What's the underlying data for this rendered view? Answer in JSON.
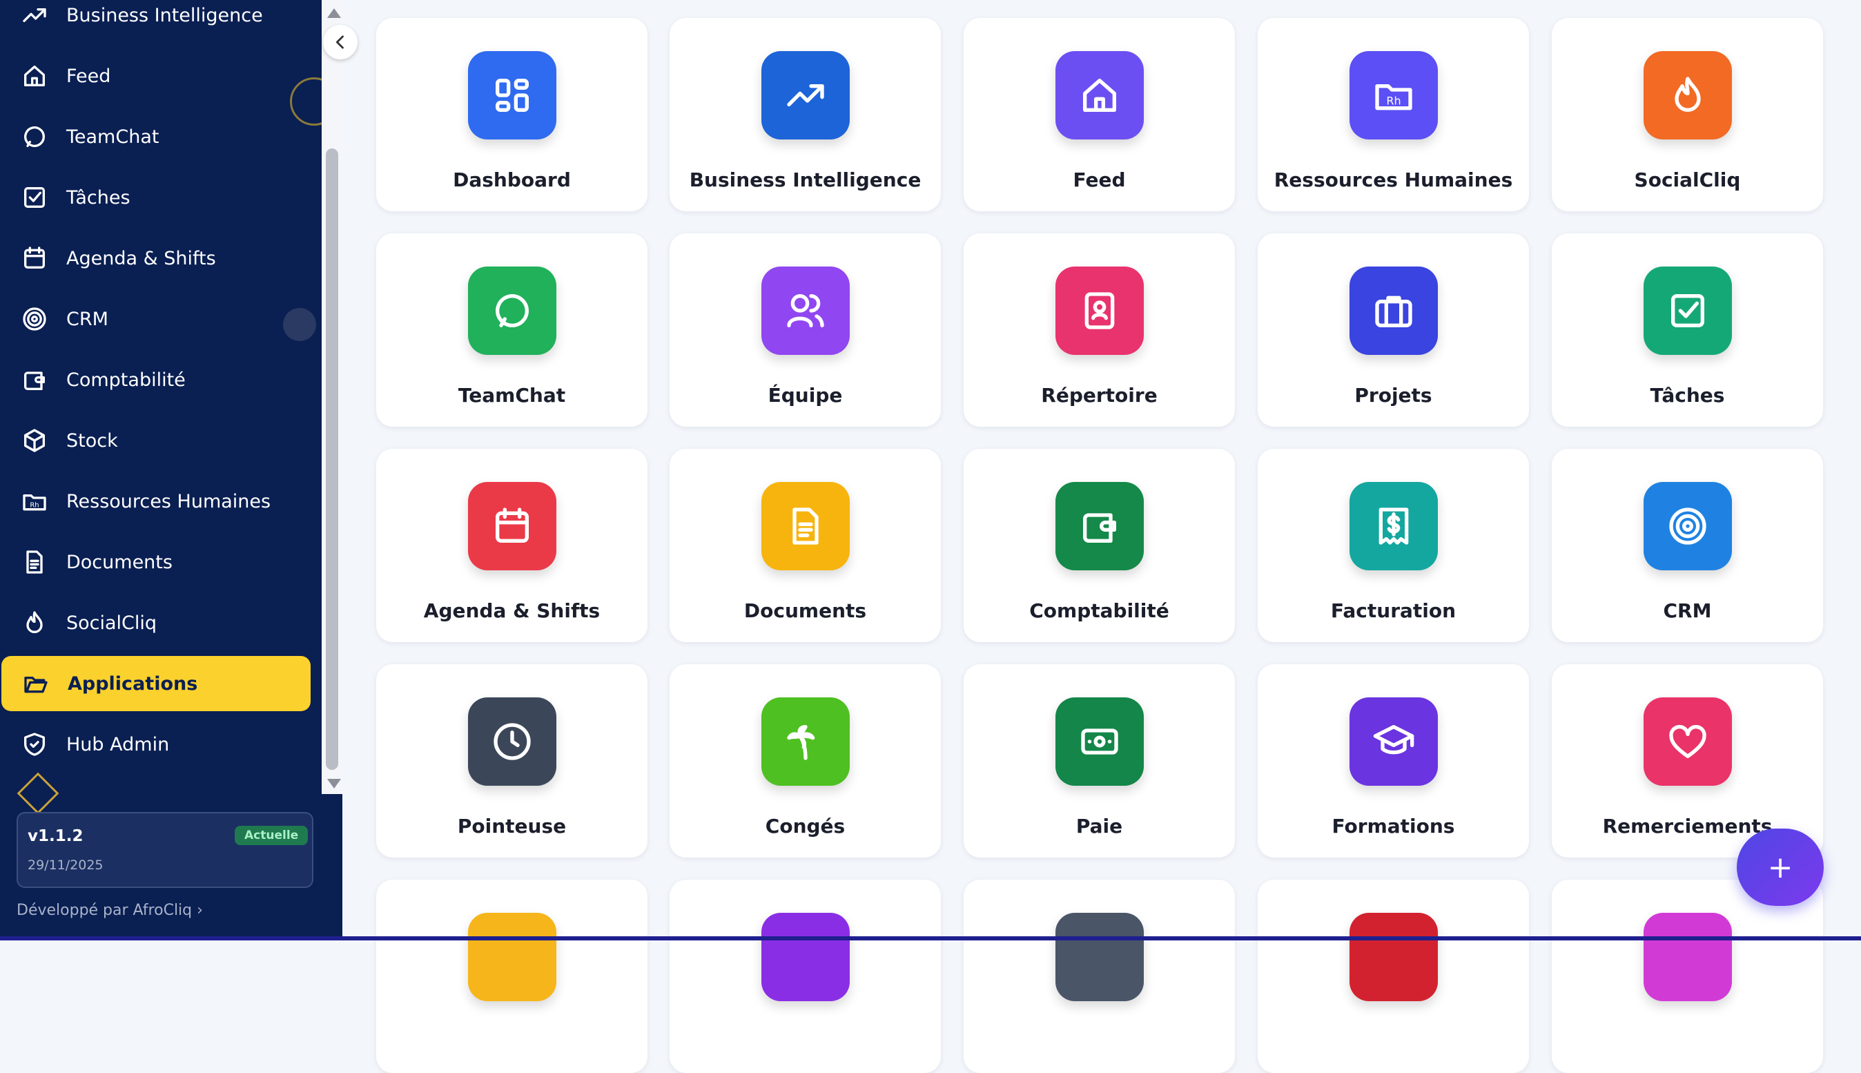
{
  "sidebar": {
    "items": [
      {
        "label": "Business Intelligence",
        "icon": "trending-up-icon"
      },
      {
        "label": "Feed",
        "icon": "home-icon"
      },
      {
        "label": "TeamChat",
        "icon": "message-circle-icon"
      },
      {
        "label": "Tâches",
        "icon": "checkbox-icon"
      },
      {
        "label": "Agenda & Shifts",
        "icon": "calendar-icon"
      },
      {
        "label": "CRM",
        "icon": "target-icon"
      },
      {
        "label": "Comptabilité",
        "icon": "wallet-icon"
      },
      {
        "label": "Stock",
        "icon": "package-icon"
      },
      {
        "label": "Ressources Humaines",
        "icon": "folder-rh-icon"
      },
      {
        "label": "Documents",
        "icon": "document-icon"
      },
      {
        "label": "SocialCliq",
        "icon": "flame-icon"
      },
      {
        "label": "Applications",
        "icon": "folder-open-icon",
        "active": true
      },
      {
        "label": "Hub Admin",
        "icon": "shield-check-icon"
      }
    ],
    "version": {
      "label": "v1.1.2",
      "date": "29/11/2025",
      "badge": "Actuelle"
    },
    "developed_by": "Développé par AfroCliq"
  },
  "apps": [
    {
      "name": "Dashboard",
      "icon": "grid-icon",
      "color": "#2f6bf0"
    },
    {
      "name": "Business Intelligence",
      "icon": "trending-up-icon",
      "color": "#1d64d8"
    },
    {
      "name": "Feed",
      "icon": "home-icon",
      "color": "#6c4ff2"
    },
    {
      "name": "Ressources Humaines",
      "icon": "folder-rh-icon",
      "color": "#5b4ff5"
    },
    {
      "name": "SocialCliq",
      "icon": "flame-icon",
      "color": "#f26a24"
    },
    {
      "name": "TeamChat",
      "icon": "message-circle-icon",
      "color": "#20b15a"
    },
    {
      "name": "Équipe",
      "icon": "users-icon",
      "color": "#9046f0"
    },
    {
      "name": "Répertoire",
      "icon": "contact-book-icon",
      "color": "#e8336e"
    },
    {
      "name": "Projets",
      "icon": "briefcase-icon",
      "color": "#3a44e0"
    },
    {
      "name": "Tâches",
      "icon": "checkbox-icon",
      "color": "#15a877"
    },
    {
      "name": "Agenda & Shifts",
      "icon": "calendar-icon",
      "color": "#ea3a48"
    },
    {
      "name": "Documents",
      "icon": "document-icon",
      "color": "#f7b40f"
    },
    {
      "name": "Comptabilité",
      "icon": "wallet-icon",
      "color": "#14894a"
    },
    {
      "name": "Facturation",
      "icon": "receipt-icon",
      "color": "#14a79f"
    },
    {
      "name": "CRM",
      "icon": "target-icon",
      "color": "#1f82e2"
    },
    {
      "name": "Pointeuse",
      "icon": "clock-icon",
      "color": "#3b4759"
    },
    {
      "name": "Congés",
      "icon": "palm-tree-icon",
      "color": "#4fc022"
    },
    {
      "name": "Paie",
      "icon": "banknote-icon",
      "color": "#148649"
    },
    {
      "name": "Formations",
      "icon": "graduation-cap-icon",
      "color": "#6a34e0"
    },
    {
      "name": "Remerciements",
      "icon": "heart-icon",
      "color": "#ea3368"
    },
    {
      "name": "",
      "icon": "app-icon-partial",
      "color": "#f6b51b"
    },
    {
      "name": "",
      "icon": "app-icon-partial",
      "color": "#8a2ee6"
    },
    {
      "name": "",
      "icon": "app-icon-partial",
      "color": "#4a5568"
    },
    {
      "name": "",
      "icon": "app-icon-partial",
      "color": "#d3222f"
    },
    {
      "name": "",
      "icon": "app-icon-partial",
      "color": "#d23ad6"
    }
  ],
  "fab": {
    "label": "+"
  }
}
